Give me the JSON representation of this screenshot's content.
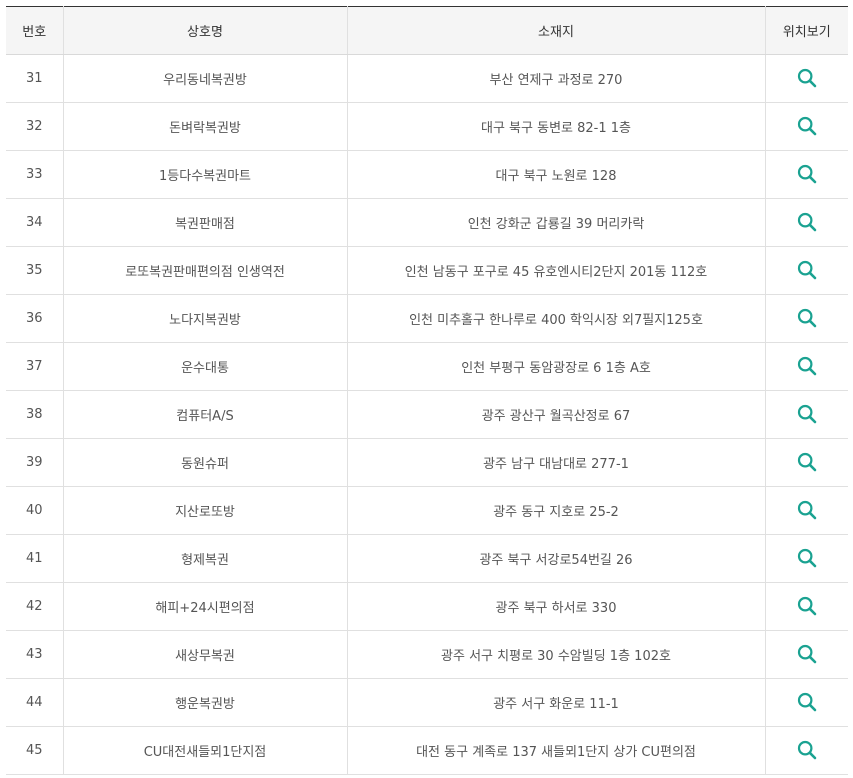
{
  "table": {
    "headers": {
      "no": "번호",
      "name": "상호명",
      "address": "소재지",
      "location": "위치보기"
    },
    "icon": "search-icon",
    "icon_color": "#1aa291",
    "rows": [
      {
        "no": "31",
        "name": "우리동네복권방",
        "address": "부산 연제구 과정로 270"
      },
      {
        "no": "32",
        "name": "돈벼락복권방",
        "address": "대구 북구 동변로 82-1 1층"
      },
      {
        "no": "33",
        "name": "1등다수복권마트",
        "address": "대구 북구 노원로 128"
      },
      {
        "no": "34",
        "name": "복권판매점",
        "address": "인천 강화군 갑룡길 39 머리카락"
      },
      {
        "no": "35",
        "name": "로또복권판매편의점 인생역전",
        "address": "인천 남동구 포구로 45 유호엔시티2단지 201동 112호"
      },
      {
        "no": "36",
        "name": "노다지복권방",
        "address": "인천 미추홀구 한나루로 400 학익시장 외7필지125호"
      },
      {
        "no": "37",
        "name": "운수대통",
        "address": "인천 부평구 동암광장로 6 1층 A호"
      },
      {
        "no": "38",
        "name": "컴퓨터A/S",
        "address": "광주 광산구 월곡산정로 67"
      },
      {
        "no": "39",
        "name": "동원슈퍼",
        "address": "광주 남구 대남대로 277-1"
      },
      {
        "no": "40",
        "name": "지산로또방",
        "address": "광주 동구 지호로 25-2"
      },
      {
        "no": "41",
        "name": "형제복권",
        "address": "광주 북구 서강로54번길 26"
      },
      {
        "no": "42",
        "name": "해피+24시편의점",
        "address": "광주 북구 하서로 330"
      },
      {
        "no": "43",
        "name": "새상무복권",
        "address": "광주 서구 치평로 30 수암빌딩 1층 102호"
      },
      {
        "no": "44",
        "name": "행운복권방",
        "address": "광주 서구 화운로 11-1"
      },
      {
        "no": "45",
        "name": "CU대전새들뫼1단지점",
        "address": "대전 동구 계족로 137 새들뫼1단지 상가 CU편의점"
      }
    ]
  }
}
